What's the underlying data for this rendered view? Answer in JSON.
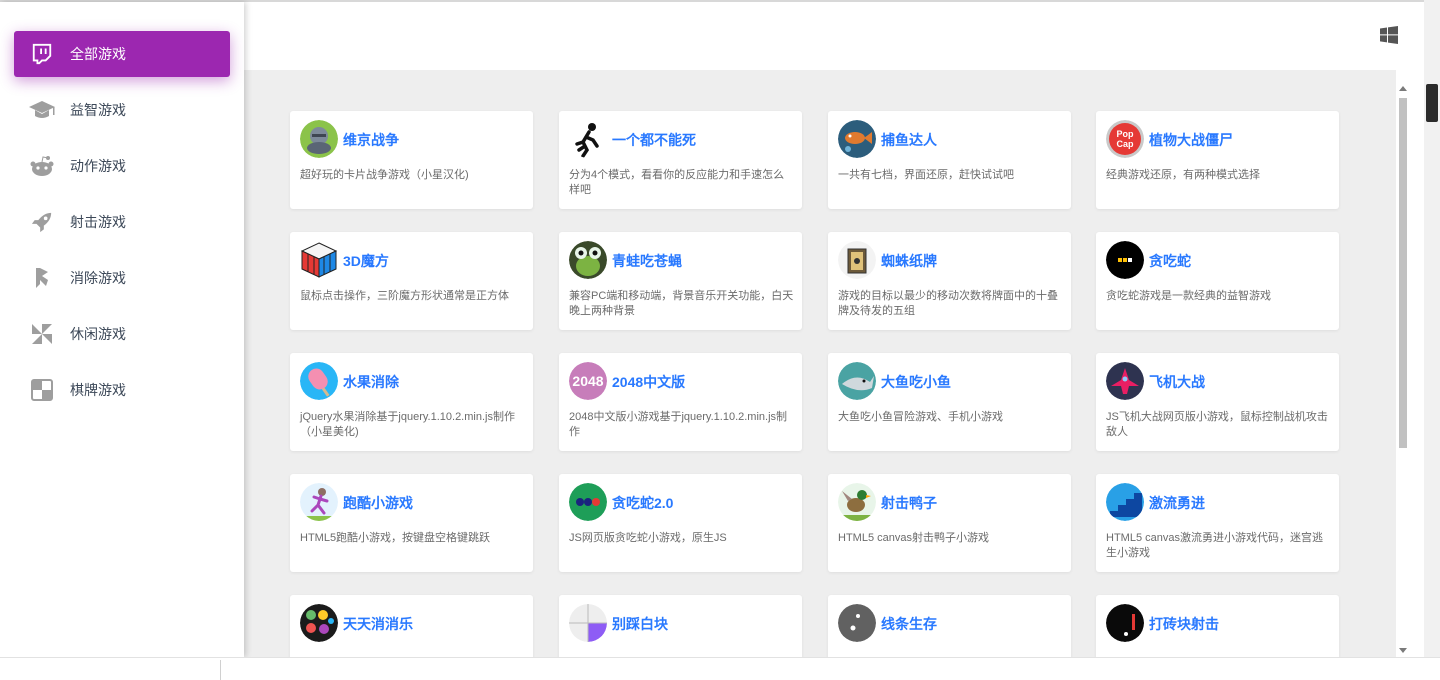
{
  "sidebar": {
    "items": [
      {
        "label": "全部游戏",
        "icon": "twitch-icon",
        "active": true
      },
      {
        "label": "益智游戏",
        "icon": "graduation-cap-icon",
        "active": false
      },
      {
        "label": "动作游戏",
        "icon": "reddit-alien-icon",
        "active": false
      },
      {
        "label": "射击游戏",
        "icon": "rocket-icon",
        "active": false
      },
      {
        "label": "消除游戏",
        "icon": "lightning-icon",
        "active": false
      },
      {
        "label": "休闲游戏",
        "icon": "pinwheel-icon",
        "active": false
      },
      {
        "label": "棋牌游戏",
        "icon": "board-grid-icon",
        "active": false
      }
    ]
  },
  "header": {
    "icon": "windows-icon"
  },
  "games": [
    {
      "title": "维京战争",
      "desc": "超好玩的卡片战争游戏（小星汉化)",
      "icon": "viking-warrior-icon"
    },
    {
      "title": "一个都不能死",
      "desc": "分为4个模式，看看你的反应能力和手速怎么样吧",
      "icon": "running-man-icon"
    },
    {
      "title": "捕鱼达人",
      "desc": "一共有七档，界面还原，赶快试试吧",
      "icon": "fish-icon"
    },
    {
      "title": "植物大战僵尸",
      "desc": "经典游戏还原，有两种模式选择",
      "icon": "popcap-logo-icon"
    },
    {
      "title": "3D魔方",
      "desc": "鼠标点击操作，三阶魔方形状通常是正方体",
      "icon": "rubiks-cube-icon"
    },
    {
      "title": "青蛙吃苍蝇",
      "desc": "兼容PC端和移动端，背景音乐开关功能，白天晚上两种背景",
      "icon": "frog-icon"
    },
    {
      "title": "蜘蛛纸牌",
      "desc": "游戏的目标以最少的移动次数将牌面中的十叠牌及待发的五组",
      "icon": "playing-cards-icon"
    },
    {
      "title": "贪吃蛇",
      "desc": "贪吃蛇游戏是一款经典的益智游戏",
      "icon": "snake-icon"
    },
    {
      "title": "水果消除",
      "desc": "jQuery水果消除基于jquery.1.10.2.min.js制作（小星美化)",
      "icon": "popsicle-icon"
    },
    {
      "title": "2048中文版",
      "desc": "2048中文版小游戏基于jquery.1.10.2.min.js制作",
      "icon": "game-2048-icon",
      "icon_text": "2048"
    },
    {
      "title": "大鱼吃小鱼",
      "desc": "大鱼吃小鱼冒险游戏、手机小游戏",
      "icon": "shark-icon"
    },
    {
      "title": "飞机大战",
      "desc": "JS飞机大战网页版小游戏，鼠标控制战机攻击敌人",
      "icon": "spaceship-icon"
    },
    {
      "title": "跑酷小游戏",
      "desc": "HTML5跑酷小游戏，按键盘空格键跳跃",
      "icon": "runner-girl-icon"
    },
    {
      "title": "贪吃蛇2.0",
      "desc": "JS网页版贪吃蛇小游戏，原生JS",
      "icon": "snake-dots-icon"
    },
    {
      "title": "射击鸭子",
      "desc": "HTML5 canvas射击鸭子小游戏",
      "icon": "duck-icon"
    },
    {
      "title": "激流勇进",
      "desc": "HTML5 canvas激流勇进小游戏代码，迷宫逃生小游戏",
      "icon": "stairs-icon"
    },
    {
      "title": "天天消消乐",
      "desc": "",
      "icon": "candy-icon"
    },
    {
      "title": "别踩白块",
      "desc": "",
      "icon": "piano-tiles-icon"
    },
    {
      "title": "线条生存",
      "desc": "",
      "icon": "dot-survival-icon"
    },
    {
      "title": "打砖块射击",
      "desc": "",
      "icon": "brick-breaker-icon"
    }
  ],
  "colors": {
    "accent": "#9c27b0",
    "title_blue": "#2979ff",
    "content_bg": "#eeeeee"
  }
}
